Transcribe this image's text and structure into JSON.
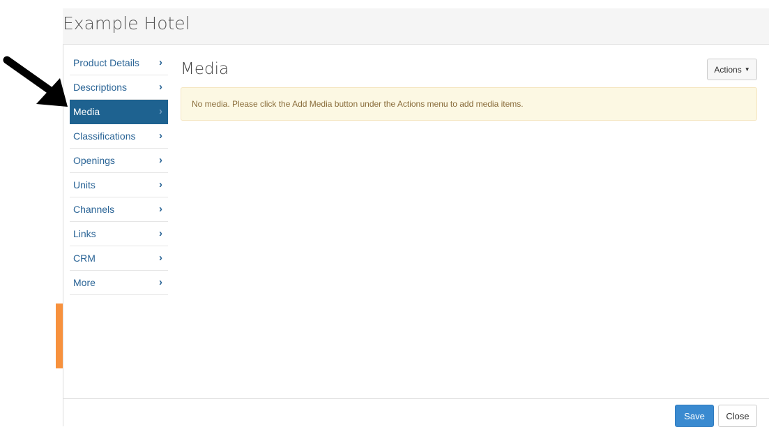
{
  "modal": {
    "title": "Example Hotel"
  },
  "sidebar": {
    "items": [
      {
        "label": "Product Details",
        "active": false
      },
      {
        "label": "Descriptions",
        "active": false
      },
      {
        "label": "Media",
        "active": true
      },
      {
        "label": "Classifications",
        "active": false
      },
      {
        "label": "Openings",
        "active": false
      },
      {
        "label": "Units",
        "active": false
      },
      {
        "label": "Channels",
        "active": false
      },
      {
        "label": "Links",
        "active": false
      },
      {
        "label": "CRM",
        "active": false
      },
      {
        "label": "More",
        "active": false
      }
    ]
  },
  "content": {
    "title": "Media",
    "actions_label": "Actions",
    "alert_text": "No media. Please click the Add Media button under the Actions menu to add media items."
  },
  "footer": {
    "save_label": "Save",
    "close_label": "Close"
  },
  "colors": {
    "active_nav": "#1e6290",
    "link": "#2a6496",
    "primary_button": "#3a8ad0",
    "alert_background": "#fcf8e3",
    "alert_text": "#8a6d3b",
    "orange_accent": "#f7913d"
  },
  "icons": {
    "nav_chevron": "chevron-right-icon",
    "actions_caret": "caret-down-icon",
    "pointer": "arrow-annotation-icon"
  }
}
